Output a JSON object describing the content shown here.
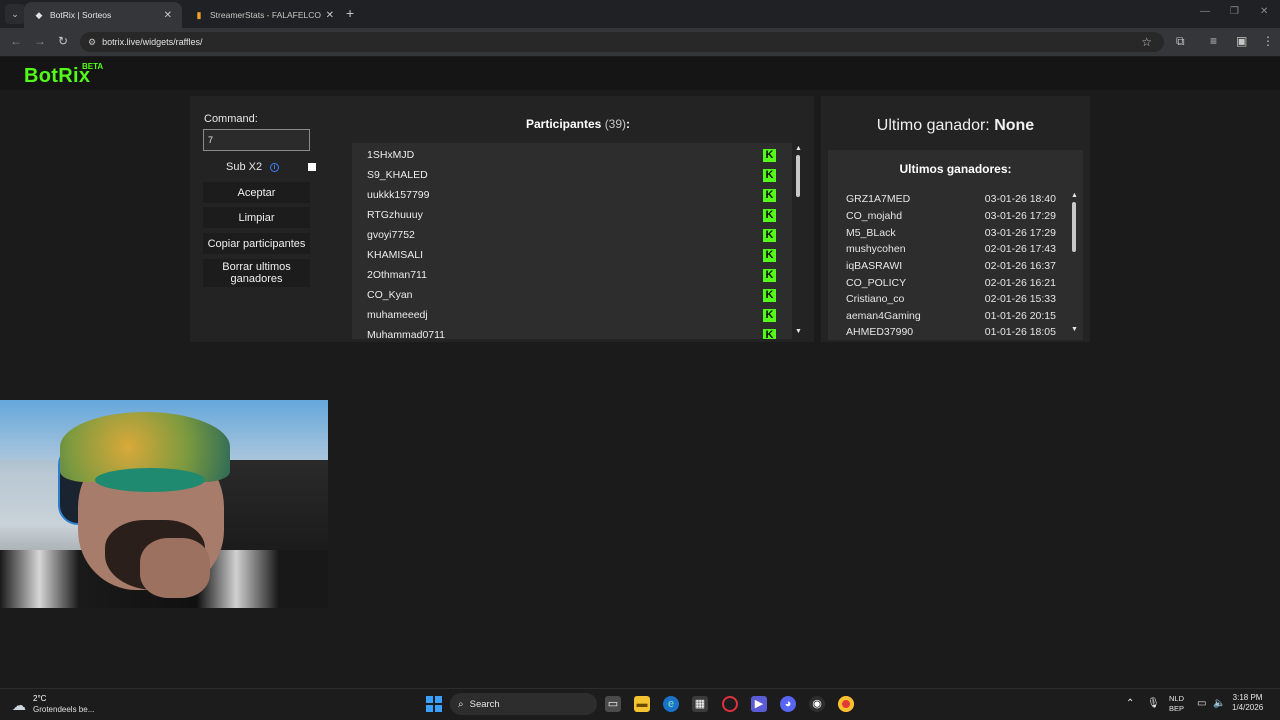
{
  "browser": {
    "tabs": [
      {
        "title": "BotRix | Sorteos",
        "active": true
      },
      {
        "title": "StreamerStats - FALAFELCO Pr...",
        "active": false
      }
    ],
    "url": "botrix.live/widgets/raffles/"
  },
  "logo": {
    "text": "BotRix",
    "badge": "BETA"
  },
  "controls": {
    "command_label": "Command:",
    "command_value": "7",
    "subx2_label": "Sub X2",
    "subx2_checked": false,
    "buttons": {
      "accept": "Aceptar",
      "clear": "Limpiar",
      "copy": "Copiar participantes",
      "delete_winners": "Borrar ultimos ganadores"
    }
  },
  "participants": {
    "title": "Participantes",
    "count": "(39)",
    "suffix": ":",
    "items": [
      "1SHxMJD",
      "S9_KHALED",
      "uukkk157799",
      "RTGzhuuuy",
      "gvoyi7752",
      "KHAMISALI",
      "2Othman711",
      "CO_Kyan",
      "muhameeedj",
      "Muhammad0711"
    ],
    "platform_icon": "kick-icon"
  },
  "last_winner": {
    "label": "Ultimo ganador:",
    "value": "None"
  },
  "recent_winners": {
    "title": "Ultimos ganadores:",
    "items": [
      {
        "name": "GRZ1A7MED",
        "date": "03-01-26 18:40"
      },
      {
        "name": "CO_mojahd",
        "date": "03-01-26 17:29"
      },
      {
        "name": "M5_BLack",
        "date": "03-01-26 17:29"
      },
      {
        "name": "mushycohen",
        "date": "02-01-26 17:43"
      },
      {
        "name": "iqBASRAWI",
        "date": "02-01-26 16:37"
      },
      {
        "name": "CO_POLICY",
        "date": "02-01-26 16:21"
      },
      {
        "name": "Cristiano_co",
        "date": "02-01-26 15:33"
      },
      {
        "name": "aeman4Gaming",
        "date": "01-01-26 20:15"
      },
      {
        "name": "AHMED37990",
        "date": "01-01-26 18:05"
      }
    ]
  },
  "taskbar": {
    "weather_temp": "2°C",
    "weather_desc": "Grotendeels be...",
    "search_placeholder": "Search",
    "lang_top": "NLD",
    "lang_bottom": "BEP",
    "time": "3:18 PM",
    "date": "1/4/2026"
  },
  "colors": {
    "brand_green": "#53fc18",
    "page_bg": "#1b1b1b",
    "panel_bg": "#232323",
    "list_bg": "#2d2d2d"
  }
}
